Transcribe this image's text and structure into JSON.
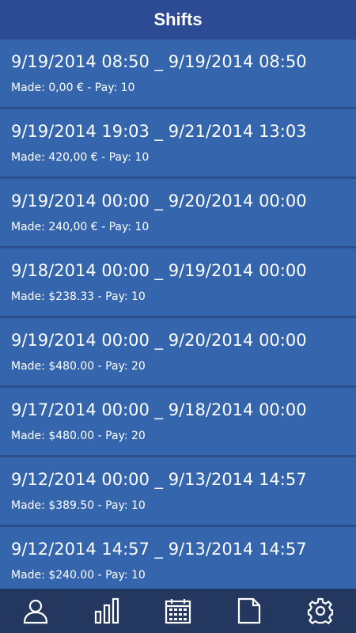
{
  "header": {
    "title": "Shifts"
  },
  "shifts": [
    {
      "range": "9/19/2014 08:50 _ 9/19/2014 08:50",
      "summary": "Made: 0,00 € - Pay: 10"
    },
    {
      "range": "9/19/2014 19:03 _ 9/21/2014 13:03",
      "summary": "Made: 420,00 € - Pay: 10"
    },
    {
      "range": "9/19/2014 00:00 _ 9/20/2014 00:00",
      "summary": "Made: 240,00 € - Pay: 10"
    },
    {
      "range": "9/18/2014 00:00 _ 9/19/2014 00:00",
      "summary": "Made: $238.33 - Pay: 10"
    },
    {
      "range": "9/19/2014 00:00 _ 9/20/2014 00:00",
      "summary": "Made: $480.00 - Pay: 20"
    },
    {
      "range": "9/17/2014 00:00 _ 9/18/2014 00:00",
      "summary": "Made: $480.00 - Pay: 20"
    },
    {
      "range": "9/12/2014 00:00 _ 9/13/2014 14:57",
      "summary": "Made: $389.50 - Pay: 10"
    },
    {
      "range": "9/12/2014 14:57 _ 9/13/2014 14:57",
      "summary": "Made: $240.00 - Pay: 10"
    }
  ],
  "nav": [
    {
      "icon": "person-icon"
    },
    {
      "icon": "bar-chart-icon"
    },
    {
      "icon": "calendar-icon"
    },
    {
      "icon": "document-icon"
    },
    {
      "icon": "gear-icon"
    }
  ],
  "colors": {
    "header": "#2d4b95",
    "row": "#3566ad",
    "divider": "#2a4f8a",
    "nav": "#23375f"
  }
}
